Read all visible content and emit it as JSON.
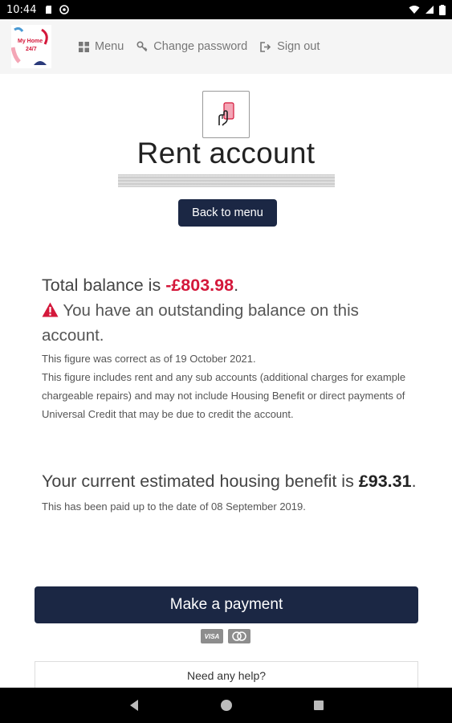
{
  "status_bar": {
    "time": "10:44"
  },
  "header": {
    "logo_text": "My Home 24/7",
    "nav": [
      {
        "label": "Menu",
        "icon": "grid-icon"
      },
      {
        "label": "Change password",
        "icon": "key-icon"
      },
      {
        "label": "Sign out",
        "icon": "sign-out-icon"
      }
    ]
  },
  "page": {
    "title": "Rent account",
    "back_button": "Back to menu"
  },
  "balance": {
    "prefix": "Total balance is ",
    "amount": "-£803.98",
    "suffix": ".",
    "warning": "You have an outstanding balance on this account.",
    "correct_as_of": "This figure was correct as of 19 October 2021.",
    "includes_note": "This figure includes rent and any sub accounts (additional charges for example chargeable repairs) and may not include Housing Benefit or direct payments of Universal Credit that may be due to credit the account."
  },
  "benefit": {
    "prefix": "Your current estimated housing benefit is ",
    "amount": "£93.31",
    "suffix": ".",
    "paid_note": "This has been paid up to the date of 08 September 2019."
  },
  "payment": {
    "button": "Make a payment",
    "card_visa": "VISA"
  },
  "help": {
    "label": "Need any help?"
  },
  "colors": {
    "navy": "#1b2744",
    "negative": "#d4183b"
  }
}
